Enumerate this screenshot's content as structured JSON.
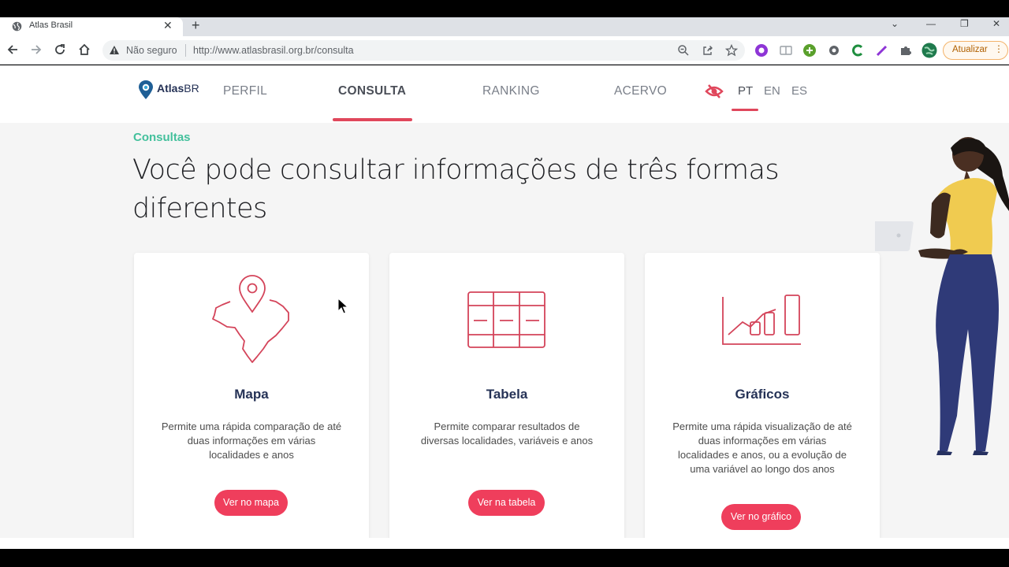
{
  "browser": {
    "tab_title": "Atlas Brasil",
    "security_label": "Não seguro",
    "url": "http://www.atlasbrasil.org.br/consulta",
    "update_label": "Atualizar",
    "icons": [
      "back-icon",
      "forward-icon",
      "reload-icon",
      "home-icon",
      "warning-icon",
      "zoom-icon",
      "share-icon",
      "star-icon",
      "extension-icon",
      "puzzle-icon",
      "profile-icon",
      "menu-dots-icon"
    ]
  },
  "site": {
    "logo_bold": "Atlas",
    "logo_light": "BR",
    "nav": {
      "perfil": "PERFIL",
      "consulta": "CONSULTA",
      "ranking": "RANKING",
      "acervo": "ACERVO"
    },
    "langs": {
      "pt": "PT",
      "en": "EN",
      "es": "ES"
    },
    "accent_color": "#ef3e5c",
    "tag_color": "#43c09c"
  },
  "main": {
    "section_tag": "Consultas",
    "headline": "Você pode consultar informações de três formas diferentes",
    "cards": [
      {
        "title": "Mapa",
        "description": "Permite uma rápida comparação de até duas informações em várias localidades e anos",
        "button": "Ver no mapa",
        "icon": "brazil-map-pin-icon"
      },
      {
        "title": "Tabela",
        "description": "Permite comparar resultados de diversas localidades, variáveis e anos",
        "button": "Ver na tabela",
        "icon": "table-icon"
      },
      {
        "title": "Gráficos",
        "description": "Permite uma rápida visualização de até duas informações em várias localidades e anos, ou a evolução de uma variável ao longo dos anos",
        "button": "Ver no gráfico",
        "icon": "chart-icon"
      }
    ]
  }
}
